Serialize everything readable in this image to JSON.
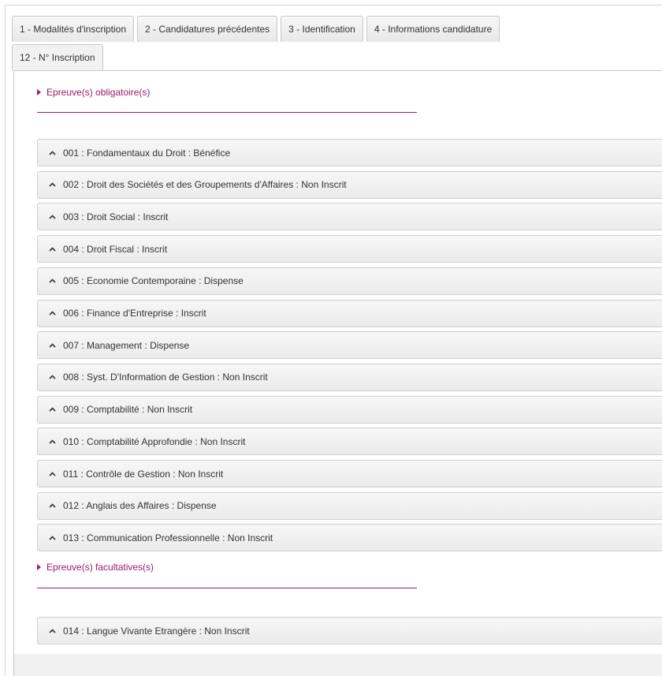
{
  "tabs_row1": [
    {
      "label": "1 - Modalités d'inscription"
    },
    {
      "label": "2 - Candidatures précédentes"
    },
    {
      "label": "3 - Identification"
    },
    {
      "label": "4 - Informations candidature"
    }
  ],
  "tabs_row2": [
    {
      "label": "12 - N° Inscription"
    }
  ],
  "sections": [
    {
      "title": "Epreuve(s) obligatoire(s)",
      "items": [
        {
          "label": "001 : Fondamentaux du Droit : Bénéfice"
        },
        {
          "label": "002 : Droit des Sociétés et des Groupements d'Affaires : Non Inscrit"
        },
        {
          "label": "003 : Droit Social : Inscrit"
        },
        {
          "label": "004 : Droit Fiscal : Inscrit"
        },
        {
          "label": "005 : Economie Contemporaine : Dispense"
        },
        {
          "label": "006 : Finance d'Entreprise : Inscrit"
        },
        {
          "label": "007 : Management : Dispense"
        },
        {
          "label": "008 : Syst. D'Information de Gestion : Non Inscrit"
        },
        {
          "label": "009 : Comptabilité : Non Inscrit"
        },
        {
          "label": "010 : Comptabilité Approfondie : Non Inscrit"
        },
        {
          "label": "011 : Contrôle de Gestion : Non Inscrit"
        },
        {
          "label": "012 : Anglais des Affaires : Dispense"
        },
        {
          "label": "013 : Communication Professionnelle : Non Inscrit"
        }
      ]
    },
    {
      "title": "Epreuve(s) facultatives(s)",
      "items": [
        {
          "label": "014 : Langue Vivante Etrangère : Non Inscrit"
        }
      ]
    }
  ],
  "icons": {
    "section_toggle": "triangle-right-icon",
    "item_toggle": "chevron-up-icon"
  },
  "colors": {
    "accent": "#9b1b6e",
    "tab_border": "#c8c8c8",
    "item_bg": "#f0f0f0"
  }
}
